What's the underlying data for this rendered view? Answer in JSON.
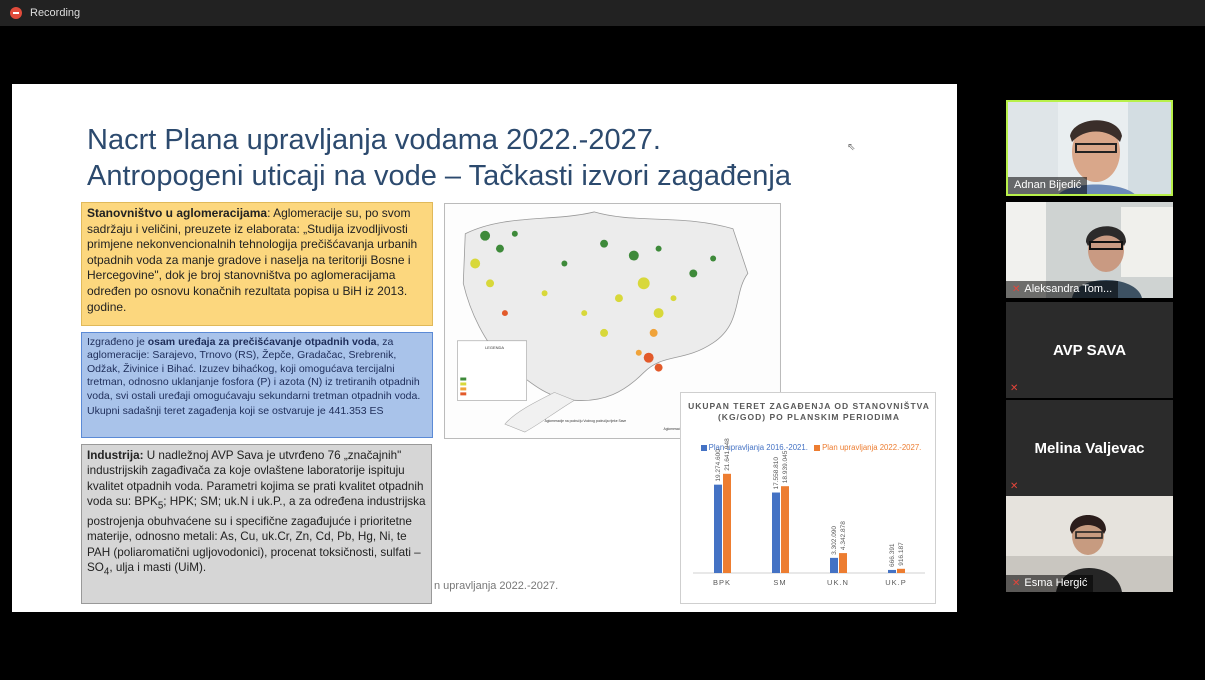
{
  "recording": {
    "label": "Recording"
  },
  "slide": {
    "title_line1": "Nacrt Plana upravljanja vodama 2022.-2027.",
    "title_line2": "Antropogeni uticaji na vode – Tačkasti izvori zagađenja",
    "box1": {
      "bold": "Stanovništvo u aglomeracijama",
      "text": ": Aglomeracije su, po svom sadržaju i veličini, preuzete iz elaborata: „Studija izvodljivosti primjene nekonvencionalnih tehnologija prečišćavanja urbanih otpadnih voda za manje gradove i naselja na teritoriji Bosne i Hercegovine\", dok je broj stanovništva po aglomeracijama određen po osnovu konačnih rezultata popisa u BiH iz 2013. godine."
    },
    "box2": {
      "prefix": "Izgrađeno je ",
      "bold": "osam uređaja za prečišćavanje otpadnih voda",
      "text": ", za aglomeracije: Sarajevo, Trnovo (RS), Žepče, Gradačac, Srebrenik, Odžak, Živinice i Bihać. Izuzev bihaćkog, koji omogućava tercijalni tretman, odnosno uklanjanje fosfora (P) i azota (N) iz tretiranih otpadnih voda, svi ostali uređaji omogućavaju sekundarni tretman otpadnih voda.",
      "last": "Ukupni sadašnji teret zagađenja koji se ostvaruje je 441.353 ES"
    },
    "box3": {
      "bold": "Industrija:",
      "text_a": " U nadležnoj AVP Sava je utvrđeno 76 „značajnih\" industrijskih zagađivača za koje ovlaštene laboratorije ispituju kvalitet otpadnih voda. Parametri kojima se prati kvalitet otpadnih voda su: BPK",
      "sub5": "5",
      "text_b": "; HPK; SM; uk.N i uk.P., a za određena industrijska postrojenja obuhvaćene su i specifične zagađujuće i prioritetne materije, odnosno metali: As, Cu, uk.Cr, Zn, Cd, Pb, Hg, Ni, te PAH (poliaromatični ugljovodonici), procenat toksičnosti, sulfati – SO",
      "sub4": "4",
      "text_c": ", ulja i masti (UiM)."
    },
    "footer": "n upravljanja 2022.-2027.",
    "map": {
      "legend_title": "LEGENDA",
      "caption_left": "Aglomeracije na području Vodnog područja rijeke Save",
      "caption_right": "Aglomeracije na području Vodnog područja rijeke Save"
    }
  },
  "chart_data": {
    "type": "bar",
    "title": "UKUPAN TERET ZAGAĐENJA OD STANOVNIŠTVA (KG/GOD) PO PLANSKIM PERIODIMA",
    "categories": [
      "BPK",
      "SM",
      "UK.N",
      "UK.P"
    ],
    "series": [
      {
        "name": "Plan upravljanja 2016.-2021.",
        "values": [
          19274600,
          17558810,
          3302090,
          666391
        ],
        "labels": [
          "19.274.600",
          "17.558.810",
          "3.302.090",
          "666.391"
        ],
        "color": "#4472c4"
      },
      {
        "name": "Plan upravljanja 2022.-2027.",
        "values": [
          21641948,
          18939045,
          4342878,
          916187
        ],
        "labels": [
          "21.641.948",
          "18.939.045",
          "4.342.878",
          "916.187"
        ],
        "color": "#ed7d31"
      }
    ],
    "ylim": [
      0,
      24000000
    ]
  },
  "participants": [
    {
      "name": "Adnan Bijedić",
      "video": true,
      "active": true,
      "muted": false
    },
    {
      "name": "Aleksandra Tom...",
      "video": true,
      "active": false,
      "muted": true
    },
    {
      "name": "AVP SAVA",
      "video": false,
      "active": false,
      "muted": true
    },
    {
      "name": "Melina Valjevac",
      "video": false,
      "active": false,
      "muted": true
    },
    {
      "name": "Esma Hergić",
      "video": true,
      "active": false,
      "muted": true
    }
  ],
  "colors": {
    "accent_active": "#b8f04a",
    "title_blue": "#2c4a6e",
    "muted_red": "#e4453a"
  }
}
